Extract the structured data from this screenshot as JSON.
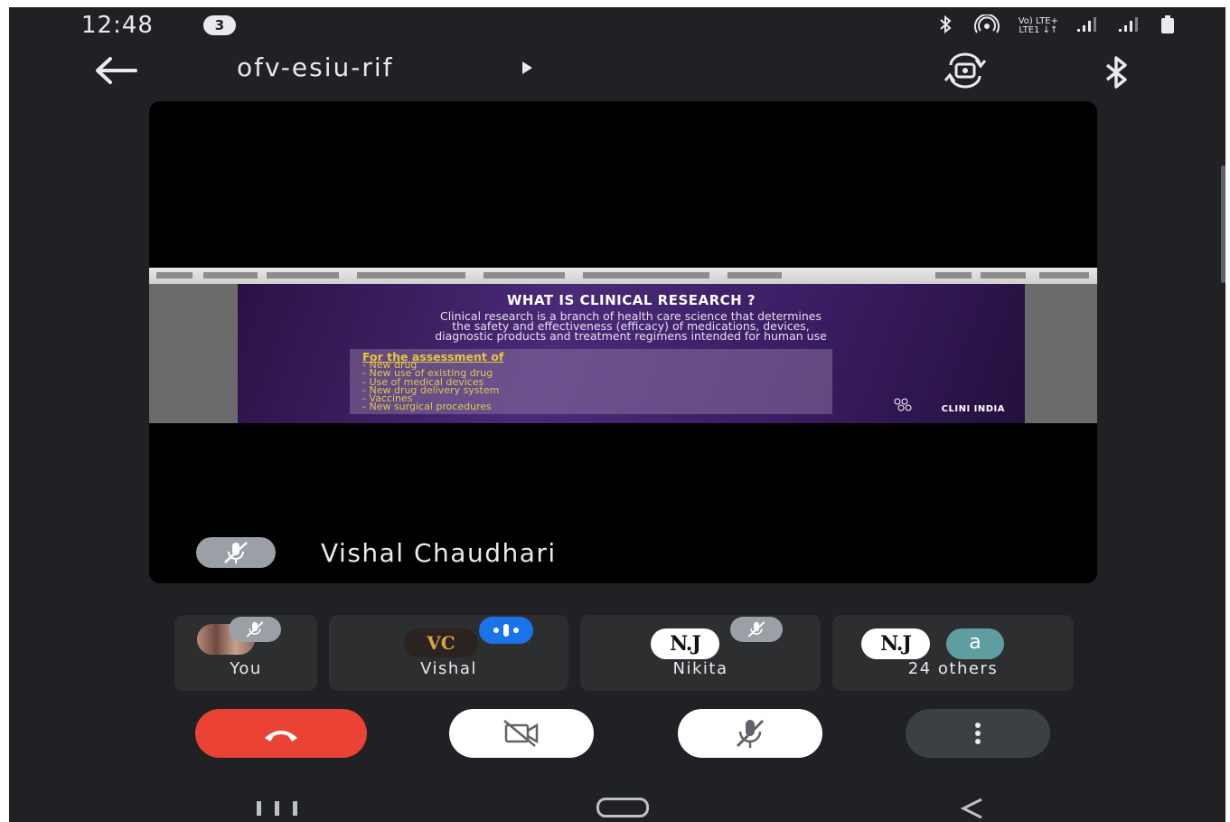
{
  "status_bar": {
    "time": "12:48",
    "notification_count": "3",
    "network_text_top": "Vo) LTE+",
    "network_text_bottom": "LTE1 ↓↑"
  },
  "top_bar": {
    "meeting_code": "ofv-esiu-rif"
  },
  "presentation": {
    "slide_title": "WHAT IS CLINICAL RESEARCH ?",
    "slide_body": "Clinical research is a branch of health care science that determines\nthe safety and effectiveness  (efficacy) of medications, devices,\ndiagnostic products and treatment regimens intended for human use",
    "assessment_heading": "For the assessment of",
    "assessment_items": [
      "- New drug",
      "- New use of existing drug",
      "- Use of medical devices",
      "- New drug delivery system",
      "- Vaccines",
      "- New surgical procedures"
    ],
    "logo_text": "CLINI INDIA"
  },
  "presenter": {
    "name": "Vishal Chaudhari"
  },
  "participants": [
    {
      "name": "You"
    },
    {
      "name": "Vishal",
      "avatar_text": "VC"
    },
    {
      "name": "Nikita",
      "avatar_text": "N.J"
    },
    {
      "name": "24 others",
      "avatar_text": "N.J",
      "extra_avatar_letter": "a"
    }
  ],
  "colors": {
    "background": "#202124",
    "end_call": "#ea4335",
    "speaking": "#1a73e8",
    "tile": "#2d2e30",
    "muted_pill": "#9aa0a6"
  },
  "icons": [
    "back-arrow-icon",
    "play-caret-icon",
    "switch-camera-icon",
    "bluetooth-icon",
    "mic-off-icon",
    "camera-off-icon",
    "end-call-icon",
    "more-options-icon"
  ]
}
